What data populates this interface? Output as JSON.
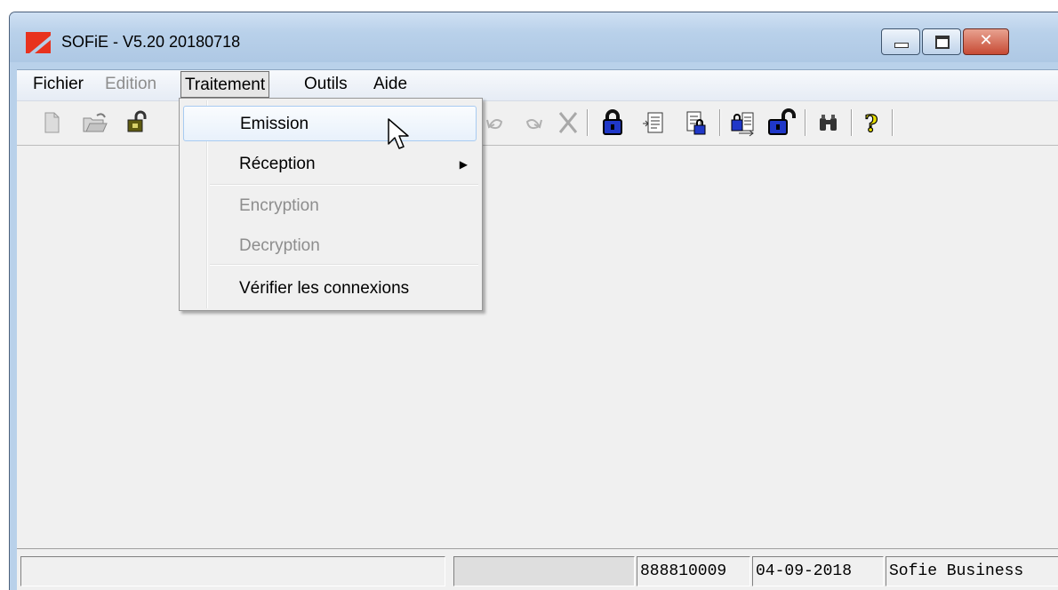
{
  "window": {
    "title": "SOFiE - V5.20 20180718"
  },
  "menubar": {
    "items": [
      {
        "label": "Fichier",
        "state": "normal"
      },
      {
        "label": "Edition",
        "state": "disabled"
      },
      {
        "label": "Traitement",
        "state": "open"
      },
      {
        "label": "Outils",
        "state": "normal"
      },
      {
        "label": "Aide",
        "state": "normal"
      }
    ]
  },
  "dropdown": {
    "parent_menu": "Traitement",
    "items": [
      {
        "label": "Emission",
        "state": "highlighted"
      },
      {
        "label": "Réception",
        "state": "normal",
        "submenu": true
      },
      {
        "label": "Encryption",
        "state": "disabled"
      },
      {
        "label": "Decryption",
        "state": "disabled"
      },
      {
        "label": "Vérifier les connexions",
        "state": "normal"
      }
    ]
  },
  "toolbar": {
    "icons": [
      "new-document-icon",
      "open-folder-icon",
      "unlock-icon",
      "undo-icon",
      "redo-icon",
      "delete-icon",
      "encrypt-lock-icon",
      "document-list-icon",
      "document-lock-icon",
      "transfer-icon",
      "decrypt-lock-icon",
      "binoculars-icon",
      "help-icon"
    ]
  },
  "statusbar": {
    "panels": [
      {
        "text": ""
      },
      {
        "text": "",
        "style": "progress"
      },
      {
        "text": "888810009"
      },
      {
        "text": "04-09-2018"
      },
      {
        "text": "Sofie Business"
      }
    ]
  },
  "colors": {
    "title_bar": "#b9d1ea",
    "client_background": "#f0f0f0",
    "highlight_border": "#a8cbf1",
    "lock_blue": "#2038c8",
    "close_button": "#c74a34"
  }
}
